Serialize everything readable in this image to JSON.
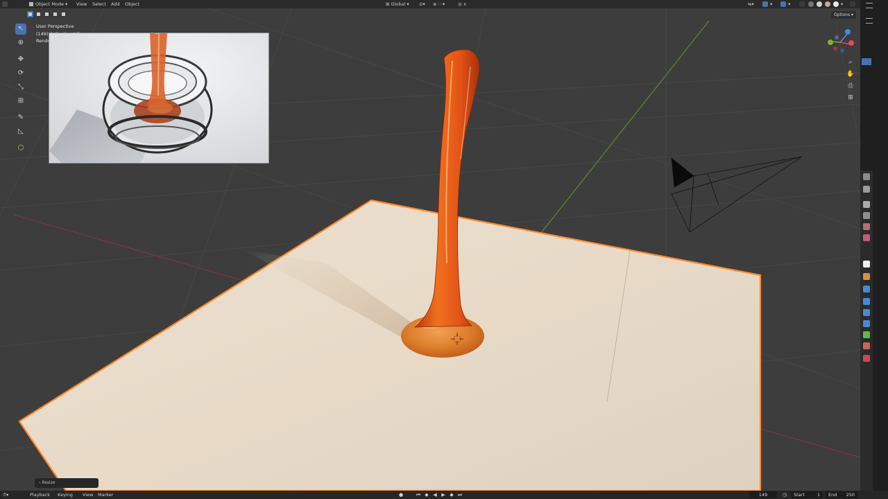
{
  "header": {
    "mode": "Object Mode",
    "menus": [
      "View",
      "Select",
      "Add",
      "Object"
    ],
    "transform_orientation": "Global"
  },
  "viewport": {
    "perspective": "User Perspective",
    "collection": "(149) Collection | Plane",
    "render_label": "Rendering"
  },
  "options_label": "Options",
  "redo_panel_label": "Resize",
  "timeline": {
    "menus": [
      "Playback",
      "Keying",
      "View",
      "Marker"
    ],
    "current_frame": "149",
    "start_label": "Start",
    "start_value": "1",
    "end_label": "End",
    "end_value": "250"
  },
  "colors": {
    "accent": "#4772b3",
    "selection_outline": "#ff8a2a",
    "x_axis": "#a03a4a",
    "y_axis": "#6e9a2e"
  },
  "icons": {
    "toolbar": [
      "select-box-icon",
      "cursor-icon",
      "move-icon",
      "rotate-icon",
      "scale-icon",
      "transform-icon",
      "annotate-icon",
      "measure-icon",
      "add-cube-icon"
    ],
    "properties": [
      "tool-icon",
      "render-icon",
      "output-icon",
      "view-layer-icon",
      "scene-icon",
      "world-icon",
      "collection-icon",
      "object-icon",
      "modifier-icon",
      "particles-icon",
      "physics-icon",
      "constraints-icon",
      "data-icon",
      "material-icon",
      "texture-icon"
    ]
  }
}
